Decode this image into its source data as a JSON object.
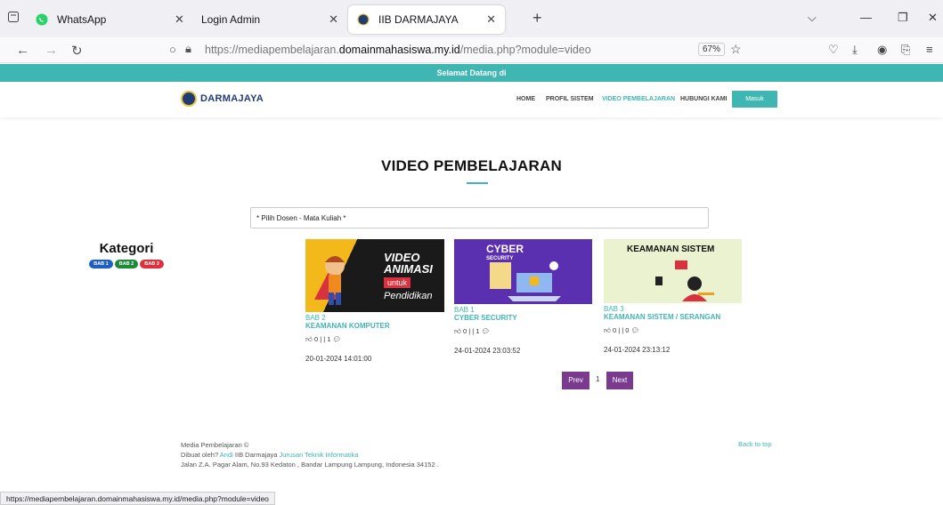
{
  "browser": {
    "tabs": [
      {
        "title": "WhatsApp"
      },
      {
        "title": "Login Admin"
      },
      {
        "title": "IIB DARMAJAYA"
      }
    ],
    "url_prefix": "https://mediapembelajaran.",
    "url_domain": "domainmahasiswa.my.id",
    "url_suffix": "/media.php?module=video",
    "zoom": "67%"
  },
  "site": {
    "welcome": "Selamat Datang di",
    "logo_text": "DARMAJAYA",
    "menu": [
      "HOME",
      "PROFIL SISTEM",
      "VIDEO PEMBELAJARAN",
      "HUBUNGI KAMI"
    ],
    "login_label": "Masuk"
  },
  "page": {
    "title": "VIDEO PEMBELAJARAN",
    "select_placeholder": "* Pilih Dosen - Mata Kuliah *",
    "kategori_title": "Kategori",
    "badges": [
      "BAB 1",
      "BAB 2",
      "BAB 3"
    ]
  },
  "videos": [
    {
      "bab": "BAB 2",
      "title": "KEAMANAN KOMPUTER",
      "stats": "0 | | 1",
      "date": "20-01-2024 14:01:00",
      "thumb": {
        "line1": "VIDEO",
        "line2": "ANIMASI",
        "line3": "untuk",
        "line4": "Pendidikan"
      }
    },
    {
      "bab": "BAB 1",
      "title": "CYBER SECURITY",
      "stats": "0 | | 1",
      "date": "24-01-2024 23:03:52",
      "thumb": {
        "line1": "CYBER",
        "line2": "SECURITY"
      }
    },
    {
      "bab": "BAB 3",
      "title": "KEAMANAN SISTEM / SERANGAN",
      "stats": "0 | | 0",
      "date": "24-01-2024 23:13:12",
      "thumb": {
        "line1": "KEAMANAN SISTEM"
      }
    }
  ],
  "pagination": {
    "prev": "Prev",
    "page": "1",
    "next": "Next"
  },
  "footer": {
    "line1": "Media Pembelajaran ©",
    "line2_a": "Dibuat oleh? ",
    "line2_author": "Andi",
    "line2_b": " IIB Darmajaya ",
    "line2_dept": "Jurusan Teknik Informatika",
    "line3": "Jalan Z.A. Pagar Alam, No.93 Kedaton , Bandar Lampung Lampung, Indonesia 34152 .",
    "back_to_top": "Back to top"
  },
  "status_url": "https://mediapembelajaran.domainmahasiswa.my.id/media.php?module=video",
  "colors": {
    "accent": "#3fb6b2",
    "bab1": "#1e5fbf",
    "bab2": "#1d8a3a",
    "bab3": "#d9323e",
    "pager": "#7a3b8f"
  }
}
